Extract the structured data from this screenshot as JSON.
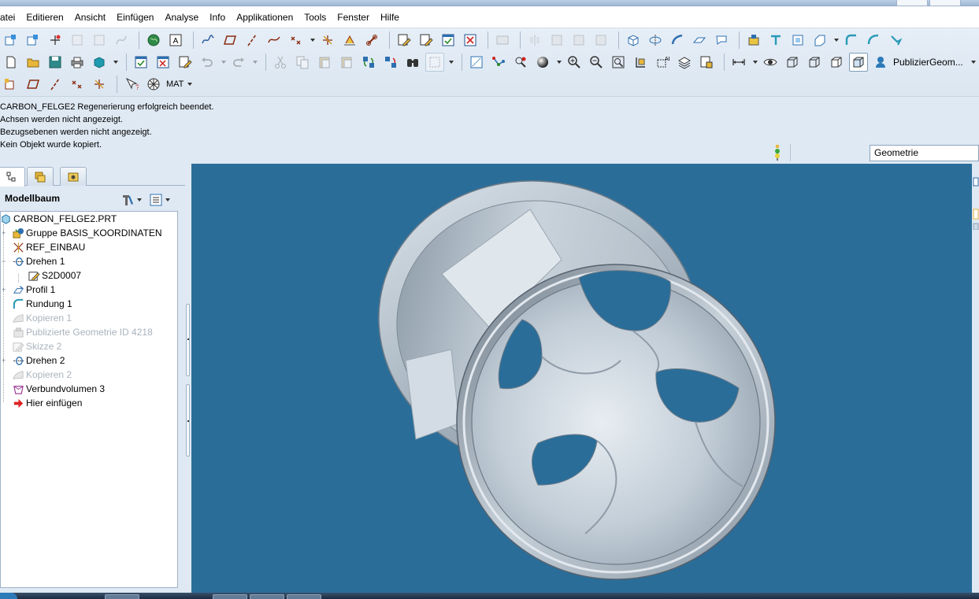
{
  "menu": [
    "atei",
    "Editieren",
    "Ansicht",
    "Einfügen",
    "Analyse",
    "Info",
    "Applikationen",
    "Tools",
    "Fenster",
    "Hilfe"
  ],
  "toolbar": {
    "publish_label": "PublizierGeom...",
    "mat_label": "MAT"
  },
  "messages": [
    "CARBON_FELGE2 Regenerierung erfolgreich beendet.",
    "Achsen werden nicht angezeigt.",
    "Bezugsebenen werden nicht angezeigt.",
    "Kein Objekt wurde kopiert."
  ],
  "filter": {
    "value": "Geometrie"
  },
  "navigator": {
    "title": "Modellbaum",
    "tree": [
      {
        "label": "CARBON_FELGE2.PRT",
        "icon": "part-icon",
        "dim": false
      },
      {
        "label": "Gruppe BASIS_KOORDINATEN",
        "icon": "group-icon",
        "dim": false
      },
      {
        "label": "REF_EINBAU",
        "icon": "datum-point-icon",
        "dim": false
      },
      {
        "label": "Drehen 1",
        "icon": "revolve-icon",
        "dim": false
      },
      {
        "label": "S2D0007",
        "icon": "sketch-icon",
        "dim": false
      },
      {
        "label": "Profil 1",
        "icon": "profile-icon",
        "dim": false
      },
      {
        "label": "Rundung 1",
        "icon": "round-icon",
        "dim": false
      },
      {
        "label": "Kopieren 1",
        "icon": "copy-icon",
        "dim": true
      },
      {
        "label": "Publizierte Geometrie ID 4218",
        "icon": "publish-geometry-icon",
        "dim": true
      },
      {
        "label": "Skizze 2",
        "icon": "sketch-icon",
        "dim": true
      },
      {
        "label": "Drehen 2",
        "icon": "revolve-icon",
        "dim": false
      },
      {
        "label": "Kopieren 2",
        "icon": "copy-icon",
        "dim": true
      },
      {
        "label": "Verbundvolumen 3",
        "icon": "blend-icon",
        "dim": false
      },
      {
        "label": "Hier einfügen",
        "icon": "insert-here-icon",
        "dim": false
      }
    ]
  },
  "colors": {
    "viewport": "#2a6d99",
    "model": "#b7c4cf",
    "accent": "#2d7ab8"
  }
}
